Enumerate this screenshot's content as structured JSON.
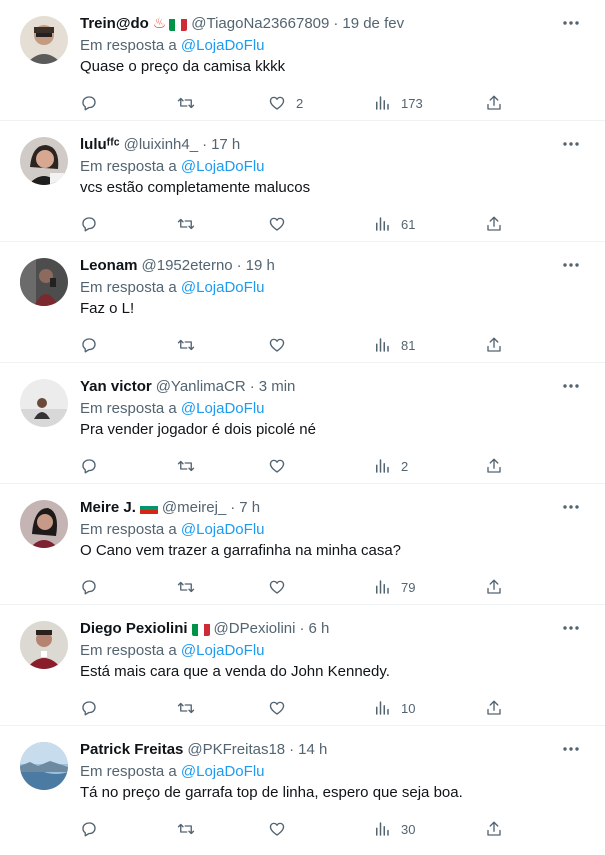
{
  "icons": {
    "reply": "reply-icon",
    "retweet": "retweet-icon",
    "like": "heart-icon",
    "views": "views-icon",
    "share": "share-icon",
    "more": "more-icon"
  },
  "colors": {
    "link": "#1d9bf0",
    "secondary": "#536471",
    "primary": "#0f1419",
    "divider": "#eff3f4"
  },
  "tweets": [
    {
      "name": "Trein@do",
      "emoji": [
        "hot-springs-emoji",
        "italy-flag"
      ],
      "handle": "@TiagoNa23667809",
      "dot": "·",
      "time": "19 de fev",
      "reply_prefix": "Em resposta a ",
      "reply_mention": "@LojaDoFlu",
      "text": "Quase o preço da camisa kkkk",
      "likes": "2",
      "views": "173",
      "avatar_bg": "#d8d2c8"
    },
    {
      "name": "luluᶠᶠᶜ",
      "emoji": [],
      "handle": "@luixinh4_",
      "dot": "·",
      "time": "17 h",
      "reply_prefix": "Em resposta a ",
      "reply_mention": "@LojaDoFlu",
      "text": "vcs estão completamente malucos",
      "likes": "",
      "views": "61",
      "avatar_bg": "#c9c4bf"
    },
    {
      "name": "Leonam",
      "emoji": [],
      "handle": "@1952eterno",
      "dot": "·",
      "time": "19 h",
      "reply_prefix": "Em resposta a ",
      "reply_mention": "@LojaDoFlu",
      "text": "Faz o L!",
      "likes": "",
      "views": "81",
      "avatar_bg": "#5a5a5a"
    },
    {
      "name": "Yan victor",
      "emoji": [],
      "handle": "@YanlimaCR",
      "dot": "·",
      "time": "3 min",
      "reply_prefix": "Em resposta a ",
      "reply_mention": "@LojaDoFlu",
      "text": "Pra vender jogador é dois picolé né",
      "likes": "",
      "views": "2",
      "avatar_bg": "#e6e6e6"
    },
    {
      "name": "Meire J.",
      "emoji": [
        "bulgaria-flag"
      ],
      "handle": "@meirej_",
      "dot": "·",
      "time": "7 h",
      "reply_prefix": "Em resposta a ",
      "reply_mention": "@LojaDoFlu",
      "text": "O Cano vem trazer a garrafinha na minha casa?",
      "likes": "",
      "views": "79",
      "avatar_bg": "#b9a7a7"
    },
    {
      "name": "Diego Pexiolini",
      "emoji": [
        "italy-flag"
      ],
      "handle": "@DPexiolini",
      "dot": "·",
      "time": "6 h",
      "reply_prefix": "Em resposta a ",
      "reply_mention": "@LojaDoFlu",
      "text": "Está mais cara que a venda do John Kennedy.",
      "likes": "",
      "views": "10",
      "avatar_bg": "#d4d0cb"
    },
    {
      "name": "Patrick Freitas",
      "emoji": [],
      "handle": "@PKFreitas18",
      "dot": "·",
      "time": "14 h",
      "reply_prefix": "Em resposta a ",
      "reply_mention": "@LojaDoFlu",
      "text": "Tá no preço de garrafa top de linha, espero que seja boa.",
      "likes": "",
      "views": "30",
      "avatar_bg": "#8fb3cf"
    }
  ]
}
